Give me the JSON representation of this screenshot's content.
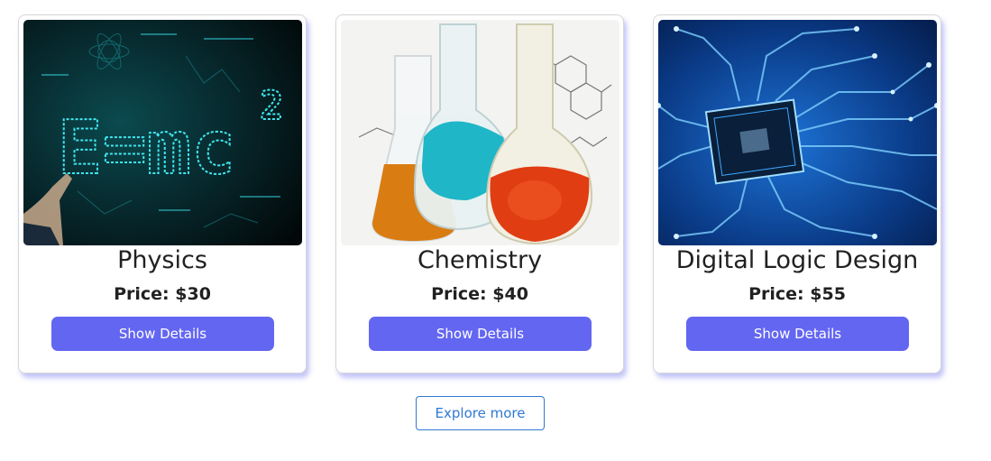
{
  "courses": [
    {
      "title": "Physics",
      "price": "Price: $30",
      "button_label": "Show Details",
      "image": "physics-emc2-image"
    },
    {
      "title": "Chemistry",
      "price": "Price: $40",
      "button_label": "Show Details",
      "image": "chemistry-flasks-image"
    },
    {
      "title": "Digital Logic Design",
      "price": "Price: $55",
      "button_label": "Show Details",
      "image": "circuit-chip-image"
    }
  ],
  "explore": {
    "label": "Explore more"
  },
  "colors": {
    "button_primary": "#6366f1",
    "explore_border": "#2f78d4",
    "card_shadow": "#787df0"
  }
}
